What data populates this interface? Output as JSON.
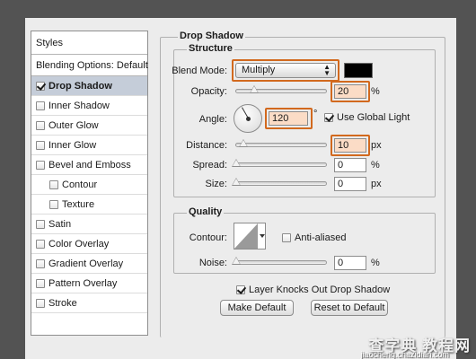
{
  "styles": {
    "header": "Styles",
    "items": [
      {
        "label": "Blending Options: Default",
        "checkbox": false
      },
      {
        "label": "Drop Shadow",
        "checkbox": true,
        "checked": true,
        "selected": true
      },
      {
        "label": "Inner Shadow",
        "checkbox": true,
        "checked": false
      },
      {
        "label": "Outer Glow",
        "checkbox": true,
        "checked": false
      },
      {
        "label": "Inner Glow",
        "checkbox": true,
        "checked": false
      },
      {
        "label": "Bevel and Emboss",
        "checkbox": true,
        "checked": false
      },
      {
        "label": "Contour",
        "checkbox": true,
        "checked": false,
        "indent": true
      },
      {
        "label": "Texture",
        "checkbox": true,
        "checked": false,
        "indent": true
      },
      {
        "label": "Satin",
        "checkbox": true,
        "checked": false
      },
      {
        "label": "Color Overlay",
        "checkbox": true,
        "checked": false
      },
      {
        "label": "Gradient Overlay",
        "checkbox": true,
        "checked": false
      },
      {
        "label": "Pattern Overlay",
        "checkbox": true,
        "checked": false
      },
      {
        "label": "Stroke",
        "checkbox": true,
        "checked": false
      }
    ]
  },
  "drop_shadow": {
    "title": "Drop Shadow",
    "structure": {
      "label": "Structure",
      "blend_mode_label": "Blend Mode:",
      "blend_mode_value": "Multiply",
      "shadow_color": "#000000",
      "opacity_label": "Opacity:",
      "opacity_value": "20",
      "opacity_unit": "%",
      "opacity_level": 0.2,
      "angle_label": "Angle:",
      "angle_value": "120",
      "angle_unit": "°",
      "use_global_light_label": "Use Global Light",
      "use_global_light_checked": true,
      "distance_label": "Distance:",
      "distance_value": "10",
      "distance_unit": "px",
      "spread_label": "Spread:",
      "spread_value": "0",
      "spread_unit": "%",
      "size_label": "Size:",
      "size_value": "0",
      "size_unit": "px"
    },
    "quality": {
      "label": "Quality",
      "contour_label": "Contour:",
      "anti_aliased_label": "Anti-aliased",
      "anti_aliased_checked": false,
      "noise_label": "Noise:",
      "noise_value": "0",
      "noise_unit": "%"
    },
    "knockout_label": "Layer Knocks Out Drop Shadow",
    "knockout_checked": true,
    "make_default_label": "Make Default",
    "reset_default_label": "Reset to Default"
  },
  "highlight_color": "#d2691e",
  "watermark": {
    "text": "查字典 教程网",
    "sub": "jiaocheng.chazidian.com"
  }
}
